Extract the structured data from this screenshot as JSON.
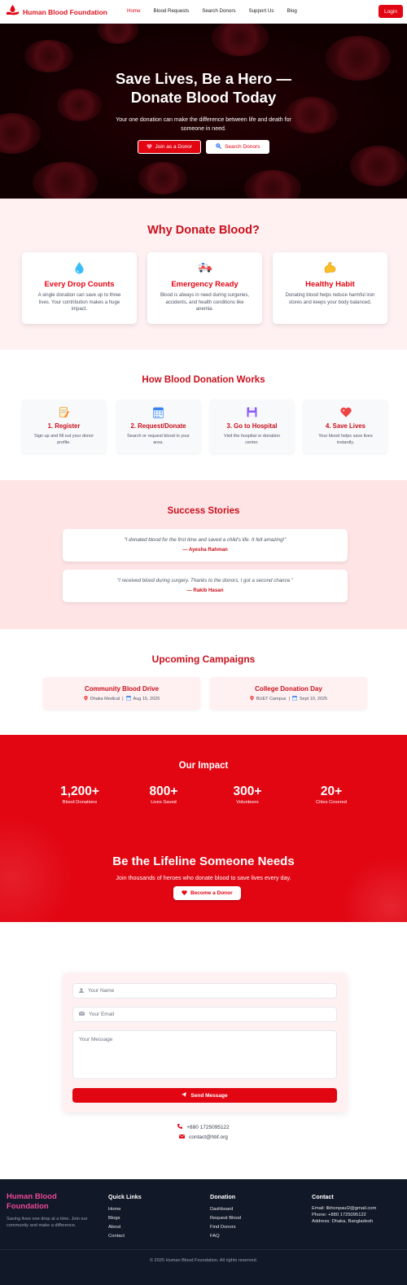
{
  "nav": {
    "brand": "Human Blood Foundation",
    "links": [
      "Home",
      "Blood Requests",
      "Search Donors",
      "Support Us",
      "Blog"
    ],
    "login": "Login"
  },
  "hero": {
    "title_line1": "Save Lives, Be a Hero —",
    "title_line2": "Donate Blood Today",
    "subtitle": "Your one donation can make the difference between life and death for someone in need.",
    "join_button": "Join as a Donor",
    "search_button": "Search Donors"
  },
  "why": {
    "title": "Why Donate Blood?",
    "cards": [
      {
        "title": "Every Drop Counts",
        "text": "A single donation can save up to three lives. Your contribution makes a huge impact.",
        "icon": "droplet-icon"
      },
      {
        "title": "Emergency Ready",
        "text": "Blood is always in need during surgeries, accidents, and health conditions like anemia.",
        "icon": "ambulance-icon"
      },
      {
        "title": "Healthy Habit",
        "text": "Donating blood helps reduce harmful iron stores and keeps your body balanced.",
        "icon": "muscle-icon"
      }
    ]
  },
  "how": {
    "title": "How Blood Donation Works",
    "steps": [
      {
        "title": "1. Register",
        "text": "Sign up and fill out your donor profile.",
        "icon": "memo-icon"
      },
      {
        "title": "2. Request/Donate",
        "text": "Search or request blood in your area.",
        "icon": "calendar-icon"
      },
      {
        "title": "3. Go to Hospital",
        "text": "Visit the hospital or donation center.",
        "icon": "floppy-icon"
      },
      {
        "title": "4. Save Lives",
        "text": "Your blood helps save lives instantly.",
        "icon": "heart-icon"
      }
    ]
  },
  "stories": {
    "title": "Success Stories",
    "items": [
      {
        "quote": "“I donated blood for the first time and saved a child’s life. It felt amazing!”",
        "author": "— Ayesha Rahman"
      },
      {
        "quote": "“I received blood during surgery. Thanks to the donors, I got a second chance.”",
        "author": "— Rakib Hasan"
      }
    ]
  },
  "campaigns": {
    "title": "Upcoming Campaigns",
    "items": [
      {
        "title": "Community Blood Drive",
        "place": "Dhaka Medical",
        "date": "Aug 15, 2025"
      },
      {
        "title": "College Donation Day",
        "place": "BUET Campus",
        "date": "Sept 10, 2025"
      }
    ]
  },
  "impact": {
    "title": "Our Impact",
    "stats": [
      {
        "number": "1,200+",
        "label": "Blood Donations"
      },
      {
        "number": "800+",
        "label": "Lives Saved"
      },
      {
        "number": "300+",
        "label": "Volunteers"
      },
      {
        "number": "20+",
        "label": "Cities Covered"
      }
    ],
    "cta_title": "Be the Lifeline Someone Needs",
    "cta_sub": "Join thousands of heroes who donate blood to save lives every day.",
    "cta_button": "Become a Donor"
  },
  "contact": {
    "name_placeholder": "Your Name",
    "email_placeholder": "Your Email",
    "message_placeholder": "Your Message",
    "send_button": "Send Message",
    "phone": "+880 1725095122",
    "email": "contact@hbf.org"
  },
  "footer": {
    "brand_line1": "Human Blood",
    "brand_line2": "Foundation",
    "desc": "Saving lives one drop at a time. Join our community and make a difference.",
    "quick_title": "Quick Links",
    "quick_links": [
      "Home",
      "Blogs",
      "About",
      "Contact"
    ],
    "donation_title": "Donation",
    "donation_links": [
      "Dashboard",
      "Request Blood",
      "Find Donors",
      "FAQ"
    ],
    "contact_title": "Contact",
    "contact_lines": [
      "Email: llkhonpaul2@gmail.com",
      "Phone: +880 1725095122",
      "Address: Dhaka, Bangladesh"
    ],
    "copyright": "© 2025 Human Blood Foundation. All rights reserved."
  },
  "colors": {
    "primary": "#e20613",
    "dark": "#111827",
    "pink_bg": "#fff1f2"
  }
}
